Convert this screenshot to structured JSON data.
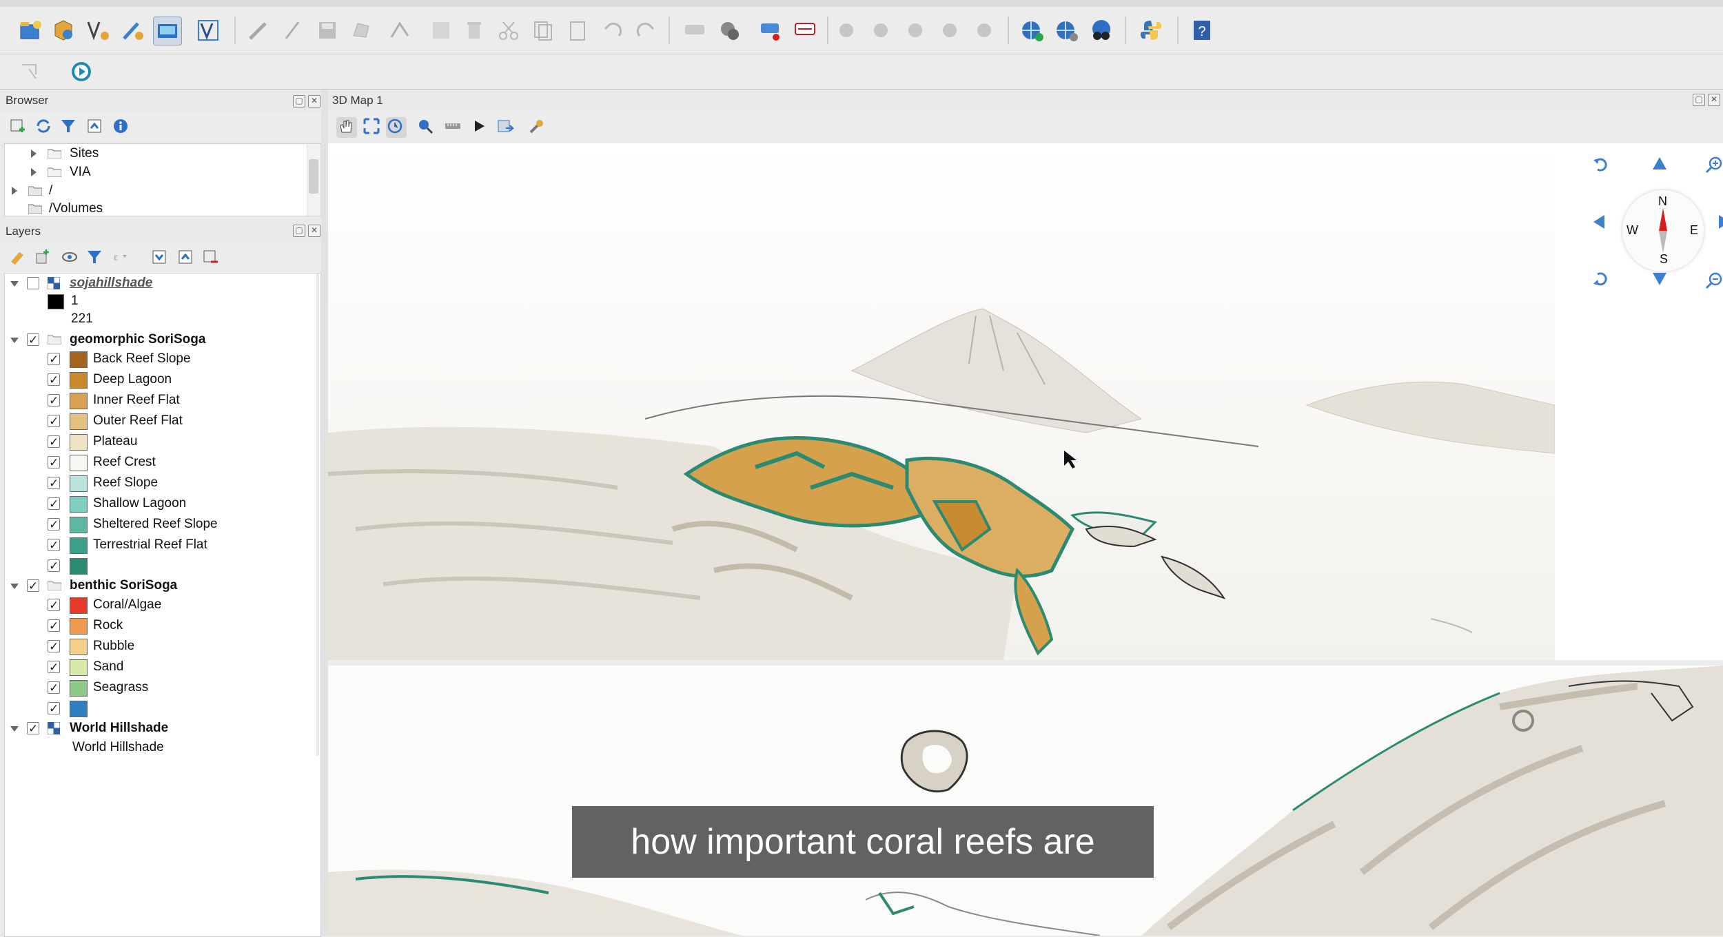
{
  "browser": {
    "title": "Browser",
    "items": [
      {
        "label": "Sites"
      },
      {
        "label": "VIA"
      },
      {
        "label": "/"
      },
      {
        "label": "/Volumes"
      }
    ]
  },
  "layers": {
    "title": "Layers",
    "hillshade": {
      "label": "sojahillshade",
      "legend": [
        {
          "label": "1",
          "color": "#000000"
        },
        {
          "label": "221"
        }
      ]
    },
    "geomorphic": {
      "label": "geomorphic SoriSoga",
      "classes": [
        {
          "label": "Back Reef Slope",
          "color": "#a5641f"
        },
        {
          "label": "Deep Lagoon",
          "color": "#c9882c"
        },
        {
          "label": "Inner Reef Flat",
          "color": "#d9a154"
        },
        {
          "label": "Outer Reef Flat",
          "color": "#e3c07f"
        },
        {
          "label": "Plateau",
          "color": "#f0e2c3"
        },
        {
          "label": "Reef Crest",
          "color": "#f9f7f2"
        },
        {
          "label": "Reef Slope",
          "color": "#b9e3dc"
        },
        {
          "label": "Shallow Lagoon",
          "color": "#7ccfc1"
        },
        {
          "label": "Sheltered Reef Slope",
          "color": "#5cb8a3"
        },
        {
          "label": "Terrestrial Reef Flat",
          "color": "#3ba08a"
        },
        {
          "label": "",
          "color": "#2a8a72"
        }
      ]
    },
    "benthic": {
      "label": "benthic SoriSoga",
      "classes": [
        {
          "label": "Coral/Algae",
          "color": "#e83a2a"
        },
        {
          "label": "Rock",
          "color": "#ef9a4e"
        },
        {
          "label": "Rubble",
          "color": "#f3cf8a"
        },
        {
          "label": "Sand",
          "color": "#d8eaa6"
        },
        {
          "label": "Seagrass",
          "color": "#8fc98a"
        },
        {
          "label": "",
          "color": "#2f7fc1"
        }
      ]
    },
    "world": {
      "label": "World Hillshade",
      "child": "World Hillshade"
    }
  },
  "map3d": {
    "title": "3D Map 1",
    "compass": {
      "n": "N",
      "s": "S",
      "e": "E",
      "w": "W"
    }
  },
  "subtitle": "how important coral reefs are"
}
